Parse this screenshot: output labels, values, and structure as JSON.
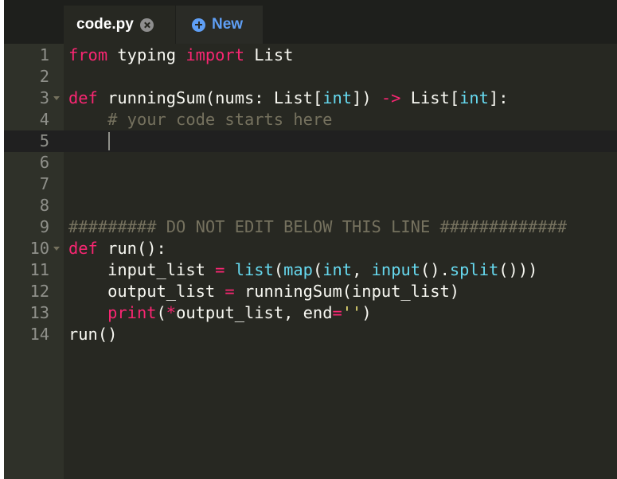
{
  "tabs": {
    "active": {
      "label": "code.py"
    },
    "new": {
      "label": "New"
    }
  },
  "editor": {
    "lines": [
      {
        "num": "1",
        "tokens": [
          {
            "t": "from",
            "c": "kw"
          },
          {
            "t": " typing ",
            "c": ""
          },
          {
            "t": "import",
            "c": "kw"
          },
          {
            "t": " List",
            "c": ""
          }
        ]
      },
      {
        "num": "2",
        "tokens": []
      },
      {
        "num": "3",
        "fold": true,
        "tokens": [
          {
            "t": "def",
            "c": "kw"
          },
          {
            "t": " runningSum(nums: List[",
            "c": ""
          },
          {
            "t": "int",
            "c": "bi"
          },
          {
            "t": "]) ",
            "c": ""
          },
          {
            "t": "->",
            "c": "kw"
          },
          {
            "t": " List[",
            "c": ""
          },
          {
            "t": "int",
            "c": "bi"
          },
          {
            "t": "]:",
            "c": ""
          }
        ]
      },
      {
        "num": "4",
        "tokens": [
          {
            "t": "    ",
            "c": ""
          },
          {
            "t": "# your code starts here",
            "c": "cm"
          }
        ]
      },
      {
        "num": "5",
        "active": true,
        "cursor": true,
        "tokens": []
      },
      {
        "num": "6",
        "tokens": []
      },
      {
        "num": "7",
        "tokens": []
      },
      {
        "num": "8",
        "tokens": []
      },
      {
        "num": "9",
        "tokens": [
          {
            "t": "######### DO NOT EDIT BELOW THIS LINE #############",
            "c": "cm"
          }
        ]
      },
      {
        "num": "10",
        "fold": true,
        "tokens": [
          {
            "t": "def",
            "c": "kw"
          },
          {
            "t": " run():",
            "c": ""
          }
        ]
      },
      {
        "num": "11",
        "tokens": [
          {
            "t": "    input_list ",
            "c": ""
          },
          {
            "t": "=",
            "c": "kw"
          },
          {
            "t": " ",
            "c": ""
          },
          {
            "t": "list",
            "c": "bi"
          },
          {
            "t": "(",
            "c": ""
          },
          {
            "t": "map",
            "c": "bi"
          },
          {
            "t": "(",
            "c": ""
          },
          {
            "t": "int",
            "c": "bi"
          },
          {
            "t": ", ",
            "c": ""
          },
          {
            "t": "input",
            "c": "bi"
          },
          {
            "t": "().",
            "c": ""
          },
          {
            "t": "split",
            "c": "bi"
          },
          {
            "t": "()))",
            "c": ""
          }
        ]
      },
      {
        "num": "12",
        "tokens": [
          {
            "t": "    output_list ",
            "c": ""
          },
          {
            "t": "=",
            "c": "kw"
          },
          {
            "t": " runningSum(input_list)",
            "c": ""
          }
        ]
      },
      {
        "num": "13",
        "tokens": [
          {
            "t": "    ",
            "c": ""
          },
          {
            "t": "print",
            "c": "kw"
          },
          {
            "t": "(",
            "c": ""
          },
          {
            "t": "*",
            "c": "kw"
          },
          {
            "t": "output_list, end",
            "c": ""
          },
          {
            "t": "=",
            "c": "kw"
          },
          {
            "t": "''",
            "c": "st"
          },
          {
            "t": ")",
            "c": ""
          }
        ]
      },
      {
        "num": "14",
        "tokens": [
          {
            "t": "run()",
            "c": ""
          }
        ]
      }
    ]
  }
}
